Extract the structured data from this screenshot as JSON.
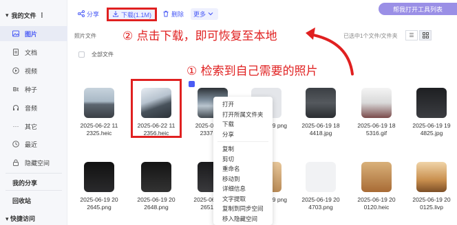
{
  "promo_label": "帮我打开工具列表",
  "sidebar": {
    "header": "我的文件",
    "items": [
      {
        "icon": "image-icon",
        "label": "图片",
        "active": true
      },
      {
        "icon": "document-icon",
        "label": "文档",
        "active": false
      },
      {
        "icon": "video-icon",
        "label": "视频",
        "active": false
      },
      {
        "icon": "bt-icon",
        "label": "种子",
        "active": false
      },
      {
        "icon": "headphones-icon",
        "label": "音频",
        "active": false
      },
      {
        "icon": "more-icon",
        "label": "其它",
        "active": false
      },
      {
        "icon": "clock-icon",
        "label": "最近",
        "active": false
      },
      {
        "icon": "lock-icon",
        "label": "隐藏空间",
        "active": false
      }
    ],
    "sections": [
      "我的分享",
      "回收站",
      "快捷访问"
    ]
  },
  "toolbar": {
    "share": "分享",
    "download": "下载(1.1M)",
    "delete": "删除",
    "more": "更多"
  },
  "breadcrumb": "照片文件",
  "selection_info": "已选中1个文件/文件夹",
  "all_files": "全部文件",
  "annotations": {
    "step2": "② 点击下载，即可恢复至本地",
    "step1": "① 检索到自己需要的照片"
  },
  "files_row1": [
    {
      "name": "2025-06-22 11 2325.heic"
    },
    {
      "name": "2025-06-22 11 2356.heic"
    },
    {
      "name": "2025-06-22 1 2337.heic"
    },
    {
      "name": "2025-06-19 png"
    },
    {
      "name": "2025-06-19 18 4418.jpg"
    },
    {
      "name": "2025-06-19 18 5316.gif"
    },
    {
      "name": "2025-06-19 19 4825.jpg"
    }
  ],
  "files_row2": [
    {
      "name": "2025-06-19 20 2645.png"
    },
    {
      "name": "2025-06-19 20 2648.png"
    },
    {
      "name": "2025-06-19 20 2651.png"
    },
    {
      "name": "2025-06-19 png"
    },
    {
      "name": "2025-06-19 20 4703.png"
    },
    {
      "name": "2025-06-19 20 0120.heic"
    },
    {
      "name": "2025-06-19 20 0125.livp"
    }
  ],
  "context_menu": {
    "group1": [
      "打开",
      "打开所属文件夹",
      "下载",
      "分享"
    ],
    "group2": [
      "复制",
      "剪切",
      "重命名",
      "移动到",
      "详细信息",
      "文字提取",
      "复制到同步空间",
      "移入隐藏空间"
    ]
  }
}
